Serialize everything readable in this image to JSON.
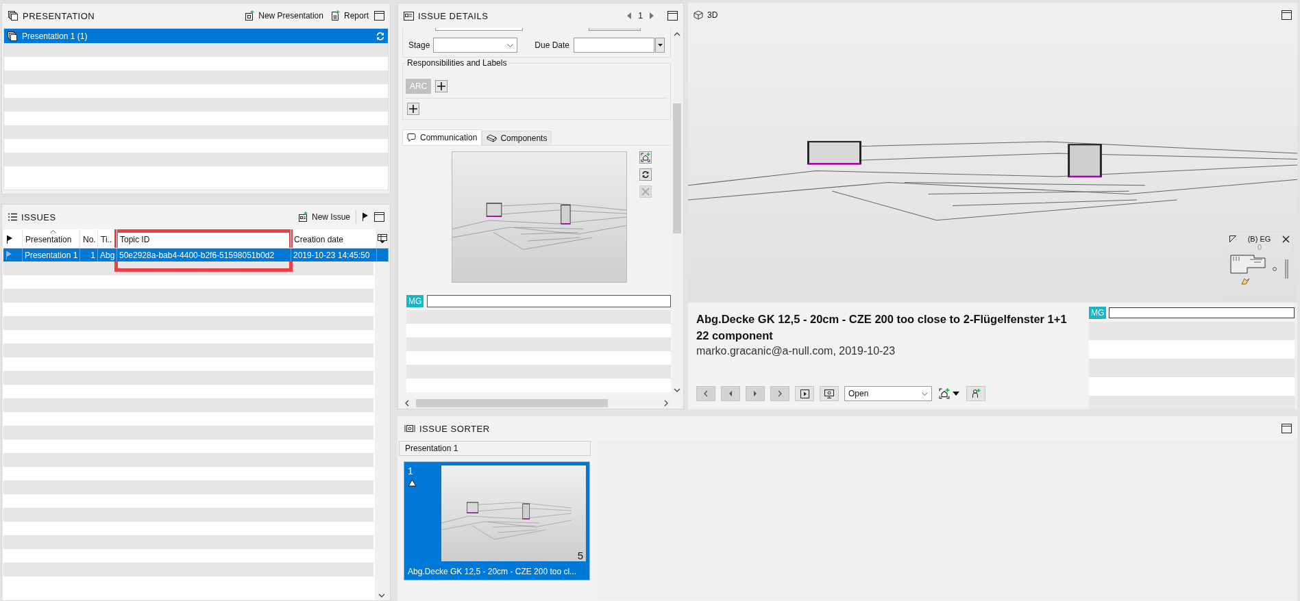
{
  "presentation_panel": {
    "title": "PRESENTATION",
    "actions": [
      "New Presentation",
      "Report"
    ],
    "items": [
      {
        "label": "Presentation 1 (1)",
        "selected": true
      }
    ]
  },
  "issues_panel": {
    "title": "ISSUES",
    "new_issue": "New Issue",
    "columns": [
      "Presentation",
      "No.",
      "Ti..",
      "Topic ID",
      "Creation date"
    ],
    "rows": [
      {
        "selected": true,
        "cells": [
          "Presentation 1",
          "1",
          "Abg",
          "50e2928a-bab4-4400-b2f6-51598051b0d2",
          "2019-10-23 14:45:50"
        ]
      }
    ]
  },
  "issue_details": {
    "title": "ISSUE DETAILS",
    "page": "1",
    "stage_label": "Stage",
    "due_date_label": "Due Date",
    "responsibilities_title": "Responsibilities and Labels",
    "labels": [
      "ARC"
    ],
    "tabs": [
      {
        "label": "Communication",
        "selected": true
      },
      {
        "label": "Components",
        "selected": false
      }
    ],
    "comment_avatar": "MG"
  },
  "viewer": {
    "title": "3D",
    "minimap_title": "(B) EG",
    "minimap_level": "0",
    "issue_title": "Abg.Decke GK 12,5 - 20cm - CZE 200 too close to 2-Flügelfenster 1+1 22 component",
    "author_line": "marko.gracanic@a-null.com, 2019-10-23",
    "status": "Open",
    "comment_avatar": "MG"
  },
  "issue_sorter": {
    "title": "ISSUE SORTER",
    "group": "Presentation 1",
    "cards": [
      {
        "number": "1",
        "count": "5",
        "caption": "Abg.Decke GK 12,5 - 20cm - CZE 200 too cl...",
        "selected": true
      }
    ]
  }
}
